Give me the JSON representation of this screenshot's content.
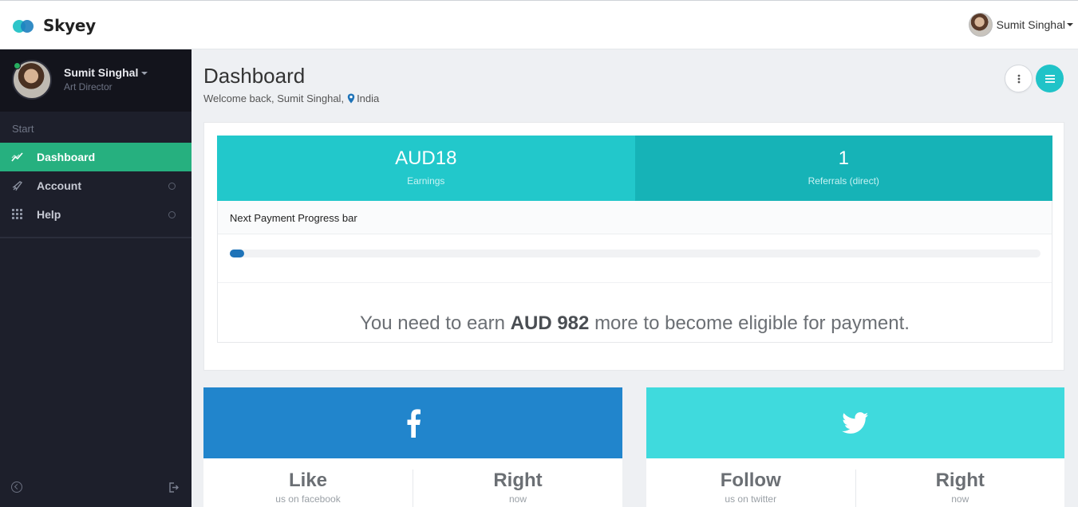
{
  "brand": {
    "name": "Skyey"
  },
  "topbar": {
    "user_name": "Sumit Singhal"
  },
  "sidebar": {
    "profile": {
      "name": "Sumit Singhal",
      "role": "Art Director"
    },
    "section_label": "Start",
    "items": [
      {
        "label": "Dashboard",
        "icon": "chart-line-icon",
        "active": true
      },
      {
        "label": "Account",
        "icon": "rocket-icon",
        "active": false
      },
      {
        "label": "Help",
        "icon": "grid-icon",
        "active": false
      }
    ]
  },
  "header": {
    "title": "Dashboard",
    "welcome": "Welcome back, Sumit Singhal,",
    "location": "India"
  },
  "stats": {
    "earnings_value": "AUD18",
    "earnings_label": "Earnings",
    "referrals_value": "1",
    "referrals_label": "Referrals (direct)"
  },
  "progress": {
    "title": "Next Payment Progress bar",
    "fraction": 0.018,
    "message_prefix": "You need to earn",
    "message_amount": "AUD 982",
    "message_suffix": "more to become eligible for payment."
  },
  "social": {
    "facebook": {
      "icon": "facebook-icon",
      "col1_big": "Like",
      "col1_small": "us on facebook",
      "col2_big": "Right",
      "col2_small": "now"
    },
    "twitter": {
      "icon": "twitter-icon",
      "col1_big": "Follow",
      "col1_small": "us on twitter",
      "col2_big": "Right",
      "col2_small": "now"
    }
  },
  "colors": {
    "accent": "#22c8cb",
    "active_nav": "#26b07f",
    "facebook": "#2185cc",
    "twitter": "#3fdadd",
    "progress": "#1e73b8"
  }
}
